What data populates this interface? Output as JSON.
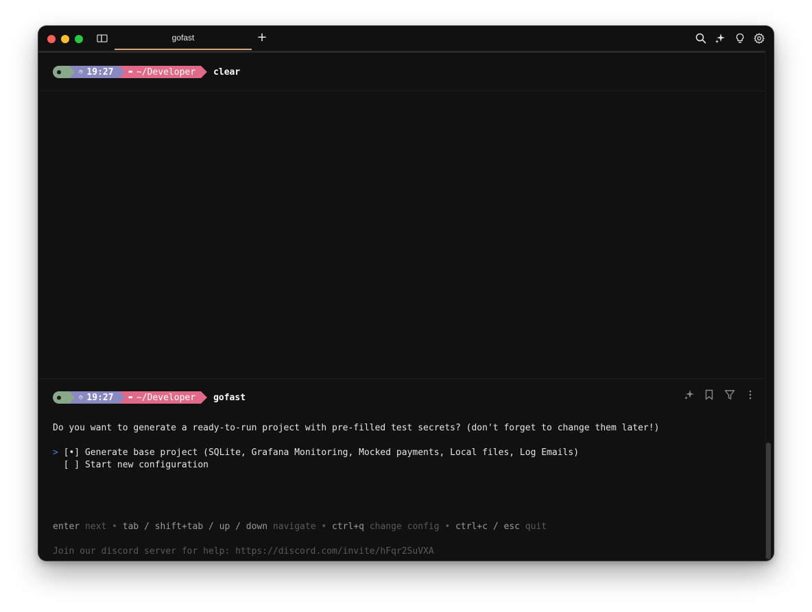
{
  "window": {
    "tab_title": "gofast"
  },
  "blocks": [
    {
      "prompt": {
        "os": "",
        "time": "19:27",
        "dir": "~/Developer"
      },
      "command": "clear"
    },
    {
      "prompt": {
        "os": "",
        "time": "19:27",
        "dir": "~/Developer"
      },
      "command": "gofast"
    }
  ],
  "output": {
    "question": "Do you want to generate a ready-to-run project with pre-filled test secrets? (don't forget to change them later!)",
    "cursor": ">",
    "options": [
      {
        "box": "[•]",
        "label": "Generate base project (SQLite, Grafana Monitoring, Mocked payments, Local files, Log Emails)"
      },
      {
        "box": "[ ]",
        "label": "Start new configuration"
      }
    ],
    "help": {
      "k1": "enter",
      "d1": "next",
      "k2": "tab / shift+tab / up / down",
      "d2": "navigate",
      "k3": "ctrl+q",
      "d3": "change config",
      "k4": "ctrl+c / esc",
      "d4": "quit",
      "sep": "•"
    },
    "discord": "Join our discord server for help: https://discord.com/invite/hFqr2SuVXA"
  },
  "icons": {
    "titlebar": [
      "search-icon",
      "ai-sparkle-icon",
      "lightbulb-icon",
      "settings-gear-icon"
    ],
    "block": [
      "ai-sparkle-icon",
      "bookmark-icon",
      "filter-icon",
      "more-vertical-icon"
    ]
  }
}
